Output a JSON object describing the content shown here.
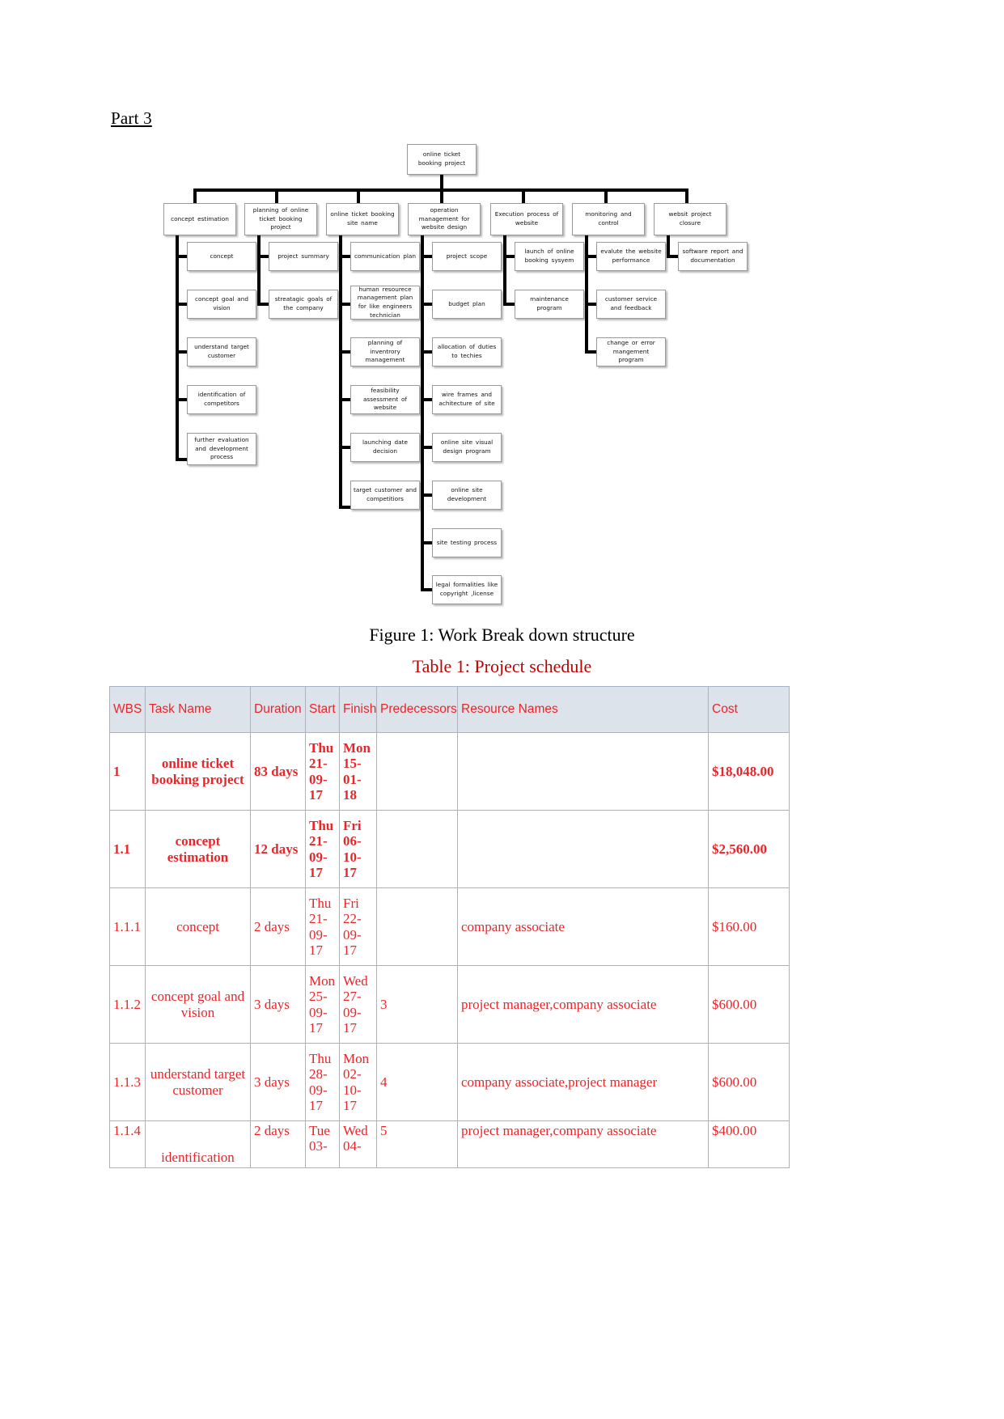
{
  "document": {
    "part_heading": "Part 3 ",
    "figure_caption": "Figure 1: Work Break down structure",
    "table_caption": "Table 1: Project schedule"
  },
  "wbs": {
    "root": "online ticket booking project",
    "branches": [
      {
        "title": "concept  estimation",
        "children": [
          "concept",
          "concept  goal and vision",
          "understand  target customer",
          "identification  of competitors",
          "further  evaluation and development process"
        ]
      },
      {
        "title": "planning  of online ticket booking project",
        "children": [
          "project  summary",
          "streatagic  goals of the company"
        ]
      },
      {
        "title": "online  ticket booking site name",
        "children": [
          "communication  plan",
          "human resourece management plan for like engineers technician",
          "planning  of inventrory management",
          "feasibility assessment of website",
          "launching  date decision",
          "target customer and competitiors"
        ]
      },
      {
        "title": "operation management for website  design",
        "children": [
          "project  scope",
          "budget plan",
          "allocation  of duties to techies",
          "wire frames and achitecture  of site",
          "online  site visual design program",
          "online  site development",
          "site testing  process",
          "legal formalities  like copyright ,license"
        ]
      },
      {
        "title": "Execution  process of website",
        "children": [
          "launch  of online booking  sysyem",
          "maintenance program"
        ]
      },
      {
        "title": "monitoring  and control",
        "children": [
          "evalute the website performance",
          "customer  service and feedback",
          "change or error mangement program"
        ]
      },
      {
        "title": "websit project closure",
        "children": [
          "software  report and documentation"
        ]
      }
    ]
  },
  "schedule": {
    "columns": [
      "WBS",
      "Task Name",
      "Duration",
      "Start",
      "Finish",
      "Predecessors",
      "Resource Names",
      "Cost"
    ],
    "rows": [
      {
        "wbs": "1",
        "task": "online ticket booking project",
        "duration": "83 days",
        "start": "Thu 21-09-17",
        "finish": "Mon 15-01-18",
        "predecessors": "",
        "resources": "",
        "cost": "$18,048.00",
        "summary": true
      },
      {
        "wbs": "1.1",
        "task": "concept estimation",
        "duration": "12 days",
        "start": "Thu 21-09-17",
        "finish": "Fri 06-10-17",
        "predecessors": "",
        "resources": "",
        "cost": "$2,560.00",
        "summary": true
      },
      {
        "wbs": "1.1.1",
        "task": "concept",
        "duration": "2 days",
        "start": "Thu 21-09-17",
        "finish": "Fri 22-09-17",
        "predecessors": "",
        "resources": "company associate",
        "cost": "$160.00",
        "summary": false
      },
      {
        "wbs": "1.1.2",
        "task": "concept goal and vision",
        "duration": "3 days",
        "start": "Mon 25-09-17",
        "finish": "Wed 27-09-17",
        "predecessors": "3",
        "resources": "project manager,company associate",
        "cost": "$600.00",
        "summary": false
      },
      {
        "wbs": "1.1.3",
        "task": "understand target customer",
        "duration": "3 days",
        "start": "Thu 28-09-17",
        "finish": "Mon 02-10-17",
        "predecessors": "4",
        "resources": "company associate,project manager",
        "cost": "$600.00",
        "summary": false
      },
      {
        "wbs": "1.1.4",
        "task": "identification",
        "duration": "2 days",
        "start": "Tue 03-",
        "finish": "Wed 04-",
        "predecessors": "5",
        "resources": "project manager,company associate",
        "cost": "$400.00",
        "summary": false
      }
    ]
  }
}
